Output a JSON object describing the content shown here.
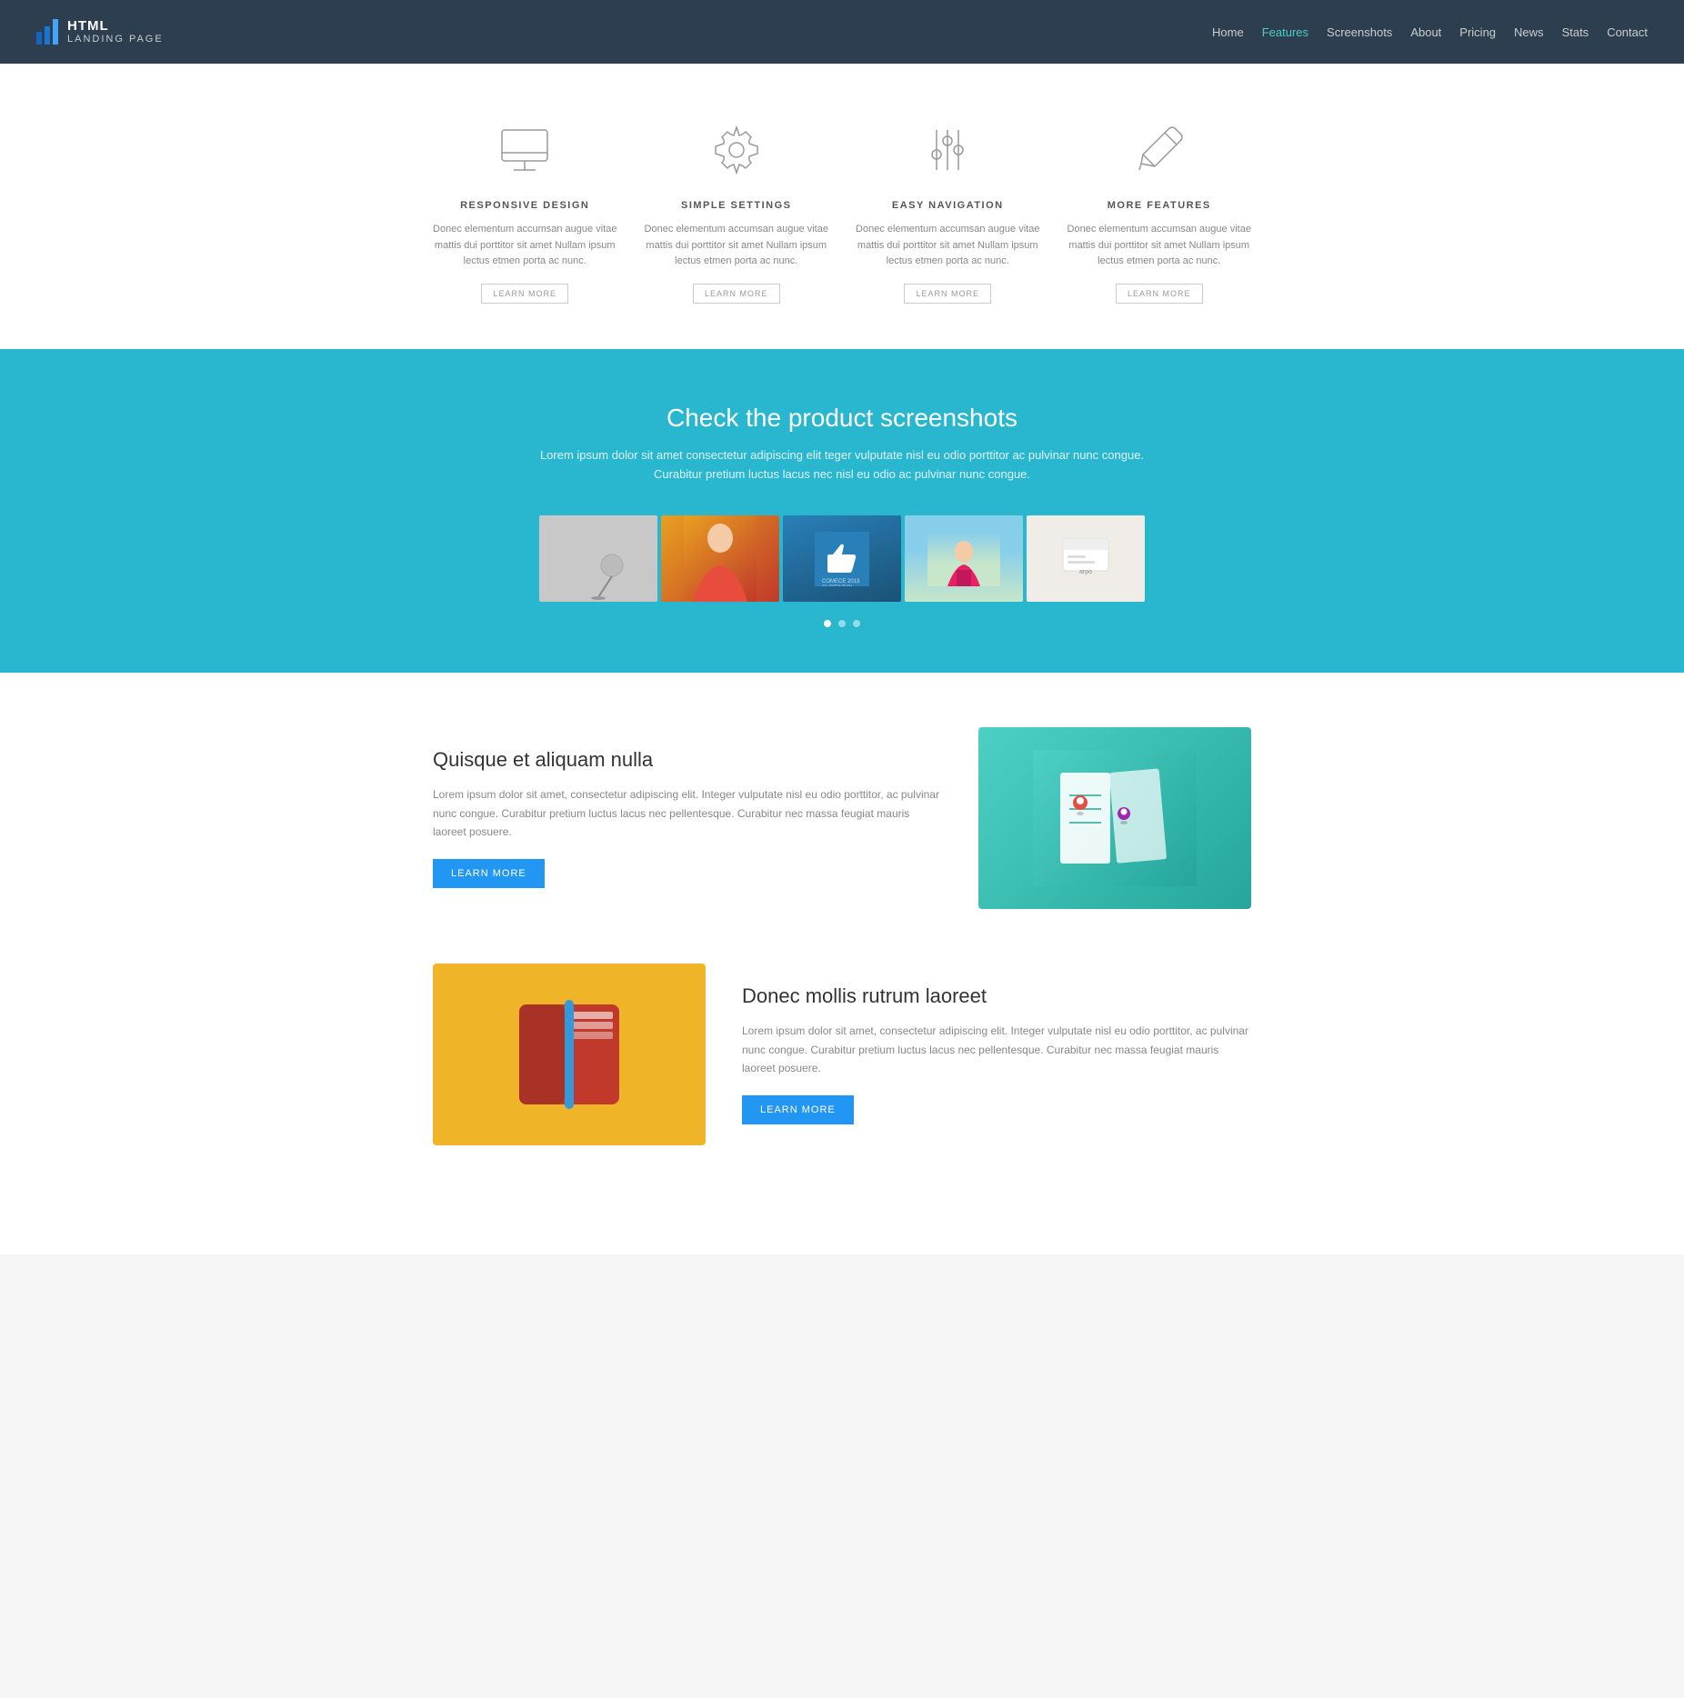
{
  "header": {
    "logo_html": "HTML",
    "logo_subtitle": "LANDING PAGE",
    "nav": [
      {
        "label": "Home",
        "active": false
      },
      {
        "label": "Features",
        "active": true
      },
      {
        "label": "Screenshots",
        "active": false
      },
      {
        "label": "About",
        "active": false
      },
      {
        "label": "Pricing",
        "active": false
      },
      {
        "label": "News",
        "active": false
      },
      {
        "label": "Stats",
        "active": false
      },
      {
        "label": "Contact",
        "active": false
      }
    ]
  },
  "features": {
    "items": [
      {
        "icon": "monitor",
        "title": "RESPONSIVE DESIGN",
        "desc": "Donec elementum accumsan augue vitae mattis dui porttitor sit amet Nullam ipsum lectus etmen porta ac nunc.",
        "btn": "LEARN MORE"
      },
      {
        "icon": "settings",
        "title": "SIMPLE SETTINGS",
        "desc": "Donec elementum accumsan augue vitae mattis dui porttitor sit amet Nullam ipsum lectus etmen porta ac nunc.",
        "btn": "LEARN MORE"
      },
      {
        "icon": "sliders",
        "title": "EASY NAVIGATION",
        "desc": "Donec elementum accumsan augue vitae mattis dui porttitor sit amet Nullam ipsum lectus etmen porta ac nunc.",
        "btn": "LEARN MORE"
      },
      {
        "icon": "pencil",
        "title": "MORE FEATURES",
        "desc": "Donec elementum accumsan augue vitae mattis dui porttitor sit amet Nullam ipsum lectus etmen porta ac nunc.",
        "btn": "LEARN MORE"
      }
    ]
  },
  "screenshots": {
    "title": "Check the product screenshots",
    "desc1": "Lorem ipsum dolor sit amet consectetur adipiscing elit teger vulputate nisl eu odio porttitor ac pulvinar nunc congue.",
    "desc2": "Curabitur pretium luctus lacus nec nisl eu odio ac pulvinar nunc congue.",
    "dots": [
      true,
      false,
      false
    ]
  },
  "about": {
    "section1": {
      "title": "Quisque et aliquam nulla",
      "desc": "Lorem ipsum dolor sit amet, consectetur adipiscing elit. Integer vulputate nisl eu odio porttitor, ac pulvinar nunc congue. Curabitur pretium luctus lacus nec pellentesque. Curabitur nec massa feugiat mauris laoreet posuere.",
      "btn": "LEARN MORE"
    },
    "section2": {
      "title": "Donec mollis rutrum laoreet",
      "desc": "Lorem ipsum dolor sit amet, consectetur adipiscing elit. Integer vulputate nisl eu odio porttitor, ac pulvinar nunc congue. Curabitur pretium luctus lacus nec pellentesque. Curabitur nec massa feugiat mauris laoreet posuere.",
      "btn": "LEARN MORE"
    }
  },
  "colors": {
    "header_bg": "#2c3e50",
    "nav_active": "#4dd0c4",
    "screenshots_bg": "#29b6cf",
    "btn_primary": "#2196F3"
  }
}
